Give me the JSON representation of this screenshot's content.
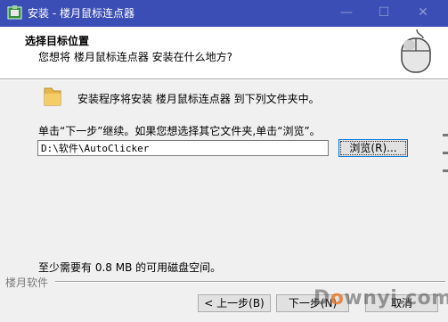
{
  "window": {
    "title": "安装 - 楼月鼠标连点器",
    "minimize": "—",
    "maximize": "☐",
    "close": "✕"
  },
  "header": {
    "title": "选择目标位置",
    "subtitle": "您想将 楼月鼠标连点器 安装在什么地方?"
  },
  "body": {
    "install_text": "安装程序将安装 楼月鼠标连点器 到下列文件夹中。",
    "instruction_text": "单击“下一步”继续。如果您想选择其它文件夹,单击“浏览”。",
    "path_value": "D:\\软件\\AutoClicker",
    "browse_label": "浏览(R)...",
    "space_text": "至少需要有 0.8 MB 的可用磁盘空间。"
  },
  "footer": {
    "brand": "楼月软件",
    "back_label": "< 上一步(B)",
    "next_label": "下一步(N)",
    "cancel_label": "取消"
  },
  "watermark": {
    "text_a": "D",
    "text_o": "o",
    "text_b": "wnyi.com"
  },
  "colors": {
    "titlebar": "#3b4eb6",
    "header_bg": "#ffffff",
    "dialog_bg": "#f0f0f0",
    "focus_border": "#0078d7"
  }
}
